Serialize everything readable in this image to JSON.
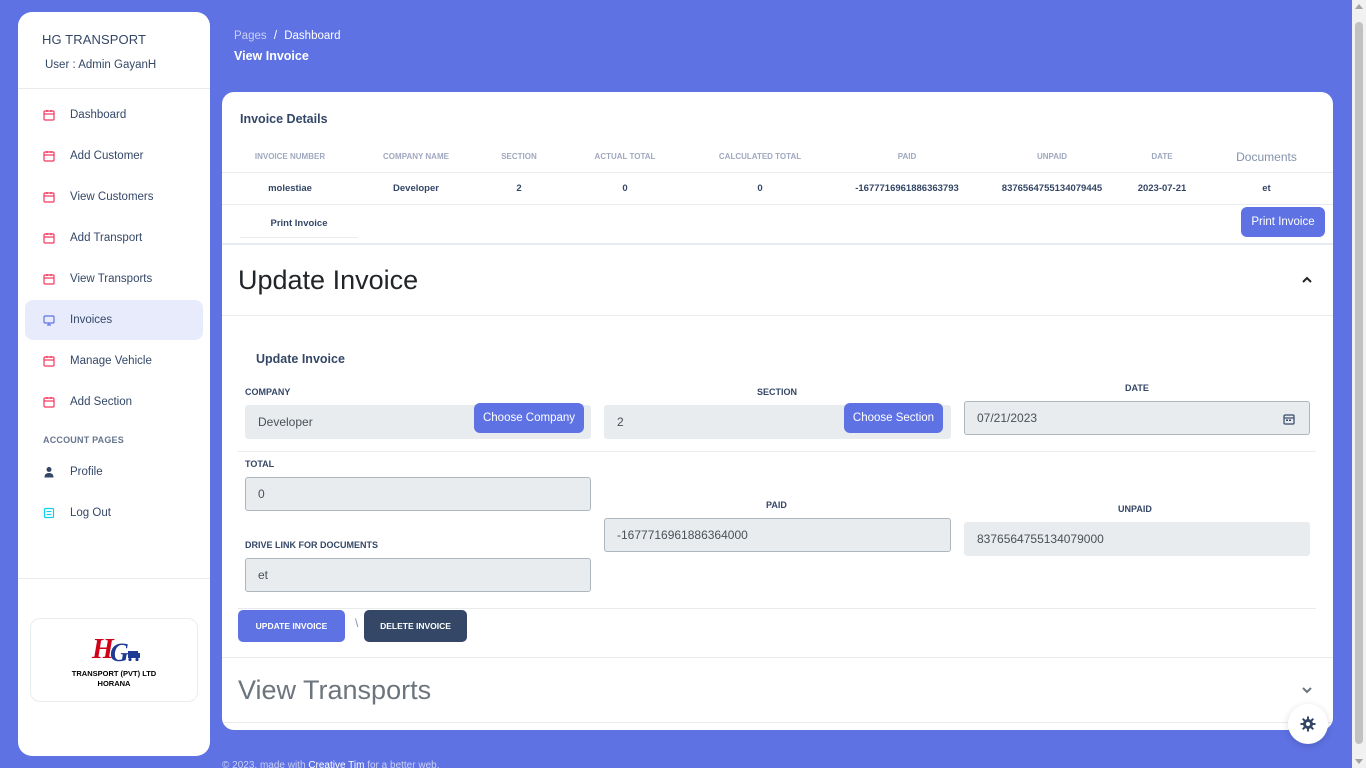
{
  "brand": {
    "title": "HG TRANSPORT",
    "user": "User : Admin GayanH"
  },
  "sidebar": {
    "items": [
      {
        "label": "Dashboard",
        "icon": "calendar-icon"
      },
      {
        "label": "Add Customer",
        "icon": "calendar-icon"
      },
      {
        "label": "View Customers",
        "icon": "calendar-icon"
      },
      {
        "label": "Add Transport",
        "icon": "calendar-icon"
      },
      {
        "label": "View Transports",
        "icon": "calendar-icon"
      },
      {
        "label": "Invoices",
        "icon": "monitor-icon",
        "active": true
      },
      {
        "label": "Manage Vehicle",
        "icon": "calendar-icon"
      },
      {
        "label": "Add Section",
        "icon": "calendar-icon"
      }
    ],
    "account_heading": "ACCOUNT PAGES",
    "account_items": [
      {
        "label": "Profile",
        "icon": "user-icon"
      },
      {
        "label": "Log Out",
        "icon": "logout-icon"
      }
    ],
    "logo_line1": "TRANSPORT (PVT) LTD",
    "logo_line2": "HORANA",
    "logo_mark": "HG"
  },
  "header": {
    "crumb_root": "Pages",
    "crumb_sep": "/",
    "crumb_current": "Dashboard",
    "title": "View Invoice"
  },
  "invoice": {
    "title": "Invoice Details",
    "columns": [
      "INVOICE NUMBER",
      "COMPANY NAME",
      "SECTION",
      "ACTUAL TOTAL",
      "CALCULATED TOTAL",
      "PAID",
      "UNPAID",
      "DATE",
      "Documents"
    ],
    "row": [
      "molestiae",
      "Developer",
      "2",
      "0",
      "0",
      "-1677716961886363793",
      "8376564755134079445",
      "2023-07-21",
      "et"
    ],
    "print_link": "Print Invoice",
    "print_button": "Print Invoice"
  },
  "update": {
    "accordion_title": "Update Invoice",
    "subtitle": "Update Invoice",
    "company_label": "COMPANY",
    "company_value": "Developer",
    "choose_company": "Choose Company",
    "section_label": "SECTION",
    "section_value": "2",
    "choose_section": "Choose Section",
    "date_label": "DATE",
    "date_value": "07/21/2023",
    "total_label": "TOTAL",
    "total_value": "0",
    "paid_label": "PAID",
    "paid_value": "-1677716961886364000",
    "unpaid_label": "UNPAID",
    "unpaid_value": "8376564755134079000",
    "drive_label": "DRIVE LINK FOR DOCUMENTS",
    "drive_value": "et",
    "update_button": "UPDATE INVOICE",
    "separator": "\\",
    "delete_button": "DELETE INVOICE"
  },
  "transports": {
    "accordion_title": "View Transports"
  },
  "footer": {
    "prefix": "© 2023, made with",
    "link": "Creative Tim",
    "suffix": "for a better web."
  },
  "colors": {
    "primary": "#5e72e4",
    "dark": "#344767",
    "accent_icon": "#f5365c"
  }
}
